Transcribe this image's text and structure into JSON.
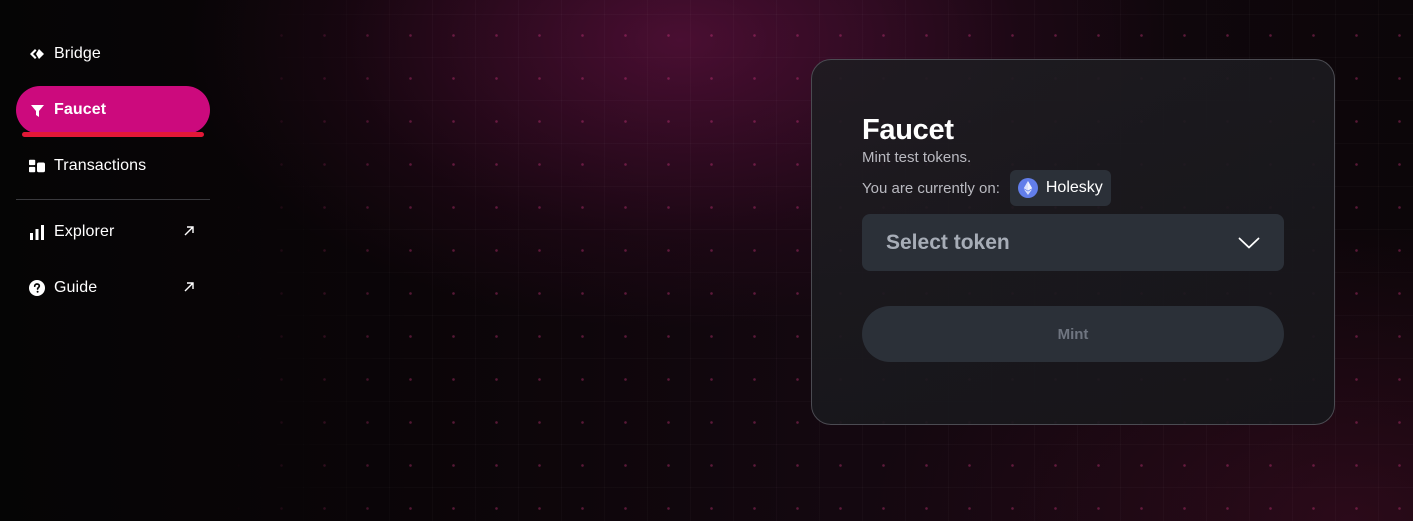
{
  "sidebar": {
    "items": [
      {
        "label": "Bridge",
        "icon": "bridge-icon"
      },
      {
        "label": "Faucet",
        "icon": "faucet-icon",
        "active": true
      },
      {
        "label": "Transactions",
        "icon": "transactions-icon"
      },
      {
        "label": "Explorer",
        "icon": "bar-chart-icon",
        "external": true
      },
      {
        "label": "Guide",
        "icon": "question-circle-icon",
        "external": true
      }
    ]
  },
  "faucet": {
    "title": "Faucet",
    "subtitle": "Mint test tokens.",
    "network_prefix": "You are currently on:",
    "network_name": "Holesky",
    "token_placeholder": "Select token",
    "mint_label": "Mint"
  },
  "colors": {
    "accent": "#cc0a7d",
    "active_underline": "#e31837",
    "card_border": "#4b4b52",
    "control_bg": "#2b3038"
  }
}
